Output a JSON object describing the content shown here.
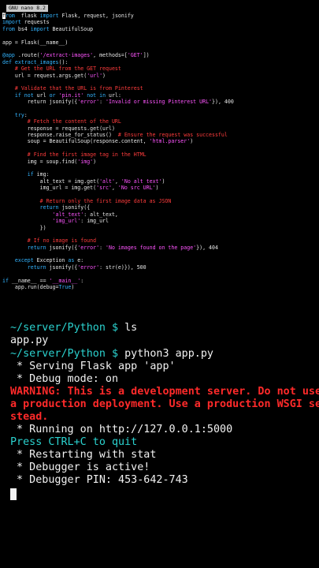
{
  "editor": {
    "title": "GNU nano 8.2",
    "cursor_char": "f",
    "lines": [
      [
        [
          "cur",
          "f"
        ],
        [
          "kw",
          "rom"
        ],
        [
          "",
          "  flask "
        ],
        [
          "kw",
          "import"
        ],
        [
          "",
          " Flask, request, jsonify"
        ]
      ],
      [
        [
          "kw",
          "import"
        ],
        [
          "",
          " requests"
        ]
      ],
      [
        [
          "kw",
          "from"
        ],
        [
          "",
          " bs4 "
        ],
        [
          "kw",
          "import"
        ],
        [
          "",
          " BeautifulSoup"
        ]
      ],
      [
        [
          "",
          ""
        ]
      ],
      [
        [
          "",
          "app = Flask(__name__)"
        ]
      ],
      [
        [
          "",
          ""
        ]
      ],
      [
        [
          "kw",
          "@app"
        ],
        [
          "",
          " .route("
        ],
        [
          "st",
          "'/extract-images'"
        ],
        [
          "",
          ", methods=["
        ],
        [
          "st",
          "'GET'"
        ],
        [
          "",
          "])"
        ]
      ],
      [
        [
          "kw",
          "def"
        ],
        [
          "",
          " "
        ],
        [
          "bi",
          "extract_images"
        ],
        [
          "",
          "():"
        ]
      ],
      [
        [
          "cm",
          "    # Get the URL from the GET request"
        ]
      ],
      [
        [
          "",
          "    url = request.args.get("
        ],
        [
          "st",
          "'url'"
        ],
        [
          "",
          ")"
        ]
      ],
      [
        [
          "",
          ""
        ]
      ],
      [
        [
          "cm",
          "    # Validate that the URL is from Pinterest"
        ]
      ],
      [
        [
          "kw",
          "    if not"
        ],
        [
          "",
          " url "
        ],
        [
          "kw",
          "or"
        ],
        [
          "",
          " "
        ],
        [
          "st",
          "'pin.it'"
        ],
        [
          "kw",
          " not in"
        ],
        [
          "",
          " url:"
        ]
      ],
      [
        [
          "",
          "        return jsonify({"
        ],
        [
          "st",
          "'error'"
        ],
        [
          "",
          ": "
        ],
        [
          "st",
          "'Invalid or missing Pinterest URL'"
        ],
        [
          "",
          "}), 400"
        ]
      ],
      [
        [
          "",
          ""
        ]
      ],
      [
        [
          "kw",
          "    try"
        ],
        [
          "",
          ":"
        ]
      ],
      [
        [
          "cm",
          "        # Fetch the content of the URL"
        ]
      ],
      [
        [
          "",
          "        response = requests.get(url)"
        ]
      ],
      [
        [
          "",
          "        response.raise_for_status()  "
        ],
        [
          "cm",
          "# Ensure the request was successful"
        ]
      ],
      [
        [
          "",
          "        soup = BeautifulSoup(response.content, "
        ],
        [
          "st",
          "'html.parser'"
        ],
        [
          "",
          ")"
        ]
      ],
      [
        [
          "",
          ""
        ]
      ],
      [
        [
          "cm",
          "        # Find the first image tag in the HTML"
        ]
      ],
      [
        [
          "",
          "        img = soup.find("
        ],
        [
          "st",
          "'img'"
        ],
        [
          "",
          ")"
        ]
      ],
      [
        [
          "",
          ""
        ]
      ],
      [
        [
          "kw",
          "        if"
        ],
        [
          "",
          " img:"
        ]
      ],
      [
        [
          "",
          "            alt_text = img.get("
        ],
        [
          "st",
          "'alt'"
        ],
        [
          "",
          ", "
        ],
        [
          "st",
          "'No alt text'"
        ],
        [
          "",
          ")"
        ]
      ],
      [
        [
          "",
          "            img_url = img.get("
        ],
        [
          "st",
          "'src'"
        ],
        [
          "",
          ", "
        ],
        [
          "st",
          "'No src URL'"
        ],
        [
          "",
          ")"
        ]
      ],
      [
        [
          "",
          ""
        ]
      ],
      [
        [
          "cm",
          "            # Return only the first image data as JSON"
        ]
      ],
      [
        [
          "kw",
          "            return"
        ],
        [
          "",
          " jsonify({"
        ]
      ],
      [
        [
          "st",
          "                'alt_text'"
        ],
        [
          "",
          ": alt_text,"
        ]
      ],
      [
        [
          "st",
          "                'img_url'"
        ],
        [
          "",
          ": img_url"
        ]
      ],
      [
        [
          "",
          "            })"
        ]
      ],
      [
        [
          "",
          ""
        ]
      ],
      [
        [
          "cm",
          "        # If no image is found"
        ]
      ],
      [
        [
          "kw",
          "        return"
        ],
        [
          "",
          " jsonify({"
        ],
        [
          "st",
          "'error'"
        ],
        [
          "",
          ": "
        ],
        [
          "st",
          "'No images found on the page'"
        ],
        [
          "",
          "}), 404"
        ]
      ],
      [
        [
          "",
          ""
        ]
      ],
      [
        [
          "kw",
          "    except"
        ],
        [
          "",
          " Exception "
        ],
        [
          "kw",
          "as"
        ],
        [
          "",
          " e:"
        ]
      ],
      [
        [
          "kw",
          "        return"
        ],
        [
          "",
          " jsonify({"
        ],
        [
          "st",
          "'error'"
        ],
        [
          "",
          ": str(e)}), 500"
        ]
      ],
      [
        [
          "",
          ""
        ]
      ],
      [
        [
          "kw",
          "if"
        ],
        [
          "",
          " __name__ == "
        ],
        [
          "st",
          "'__main__'"
        ],
        [
          "",
          ":"
        ]
      ],
      [
        [
          "",
          "    app.run(debug="
        ],
        [
          "kw",
          "True"
        ],
        [
          "",
          ")"
        ]
      ]
    ]
  },
  "terminal": {
    "lines": [
      {
        "parts": [
          [
            "prompt",
            "~/server/Python $ "
          ],
          [
            "",
            "ls"
          ]
        ]
      },
      {
        "parts": [
          [
            "",
            "app.py"
          ]
        ]
      },
      {
        "parts": [
          [
            "prompt",
            "~/server/Python $ "
          ],
          [
            "",
            "python3 app.py"
          ]
        ]
      },
      {
        "parts": [
          [
            "",
            " * Serving Flask app 'app'"
          ]
        ]
      },
      {
        "parts": [
          [
            "",
            " * Debug mode: on"
          ]
        ]
      },
      {
        "parts": [
          [
            "warn",
            "WARNING: This is a development server. Do not use"
          ]
        ]
      },
      {
        "parts": [
          [
            "warn",
            "a production deployment. Use a production WSGI se"
          ]
        ]
      },
      {
        "parts": [
          [
            "warn",
            "stead."
          ]
        ]
      },
      {
        "parts": [
          [
            "",
            " * Running on http://127.0.0.1:5000"
          ]
        ]
      },
      {
        "parts": [
          [
            "cyan",
            "Press CTRL+C to quit"
          ]
        ]
      },
      {
        "parts": [
          [
            "",
            " * Restarting with stat"
          ]
        ]
      },
      {
        "parts": [
          [
            "",
            " * Debugger is active!"
          ]
        ]
      },
      {
        "parts": [
          [
            "",
            " * Debugger PIN: 453-642-743"
          ]
        ]
      }
    ]
  }
}
